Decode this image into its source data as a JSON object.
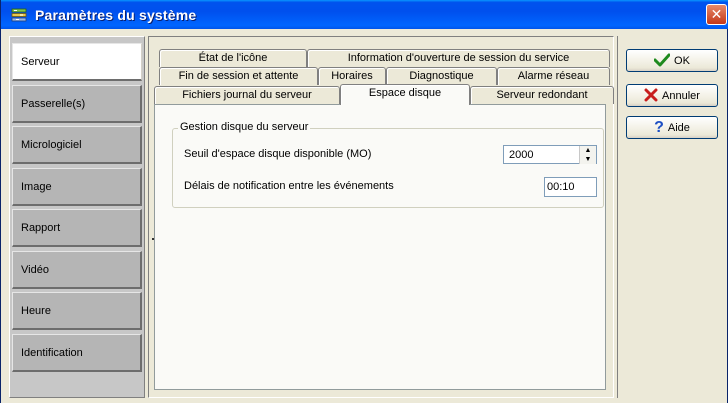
{
  "window": {
    "title": "Paramètres du système",
    "close_glyph": "✕"
  },
  "sidebar": {
    "items": [
      {
        "label": "Serveur",
        "active": true
      },
      {
        "label": "Passerelle(s)",
        "active": false
      },
      {
        "label": "Micrologiciel",
        "active": false
      },
      {
        "label": "Image",
        "active": false
      },
      {
        "label": "Rapport",
        "active": false
      },
      {
        "label": "Vidéo",
        "active": false
      },
      {
        "label": "Heure",
        "active": false
      },
      {
        "label": "Identification",
        "active": false
      }
    ]
  },
  "tabs": {
    "row1": [
      "État de l'icône",
      "Information d'ouverture de session du service"
    ],
    "row2": [
      "Fin de session et attente",
      "Horaires",
      "Diagnostique",
      "Alarme réseau"
    ],
    "row3": [
      "Fichiers journal du serveur",
      "Espace disque",
      "Serveur redondant"
    ],
    "active": "Espace disque"
  },
  "disk": {
    "group_title": "Gestion disque du serveur",
    "threshold_label": "Seuil d'espace disque disponible (MO)",
    "threshold_value": "2000",
    "delay_label": "Délais de notification entre les événements",
    "delay_value": "00:10"
  },
  "actions": {
    "ok": {
      "label": "OK",
      "icon": "check-icon",
      "color": "#1e8a1e"
    },
    "cancel": {
      "label": "Annuler",
      "icon": "x-icon",
      "color": "#c81e1e"
    },
    "help": {
      "label": "Aide",
      "icon": "question-icon",
      "color": "#1d4fc4"
    }
  },
  "colors": {
    "title_blue": "#0054e3",
    "dialog_bg": "#ece9d8",
    "sidebar_bg": "#b5b5b5"
  }
}
